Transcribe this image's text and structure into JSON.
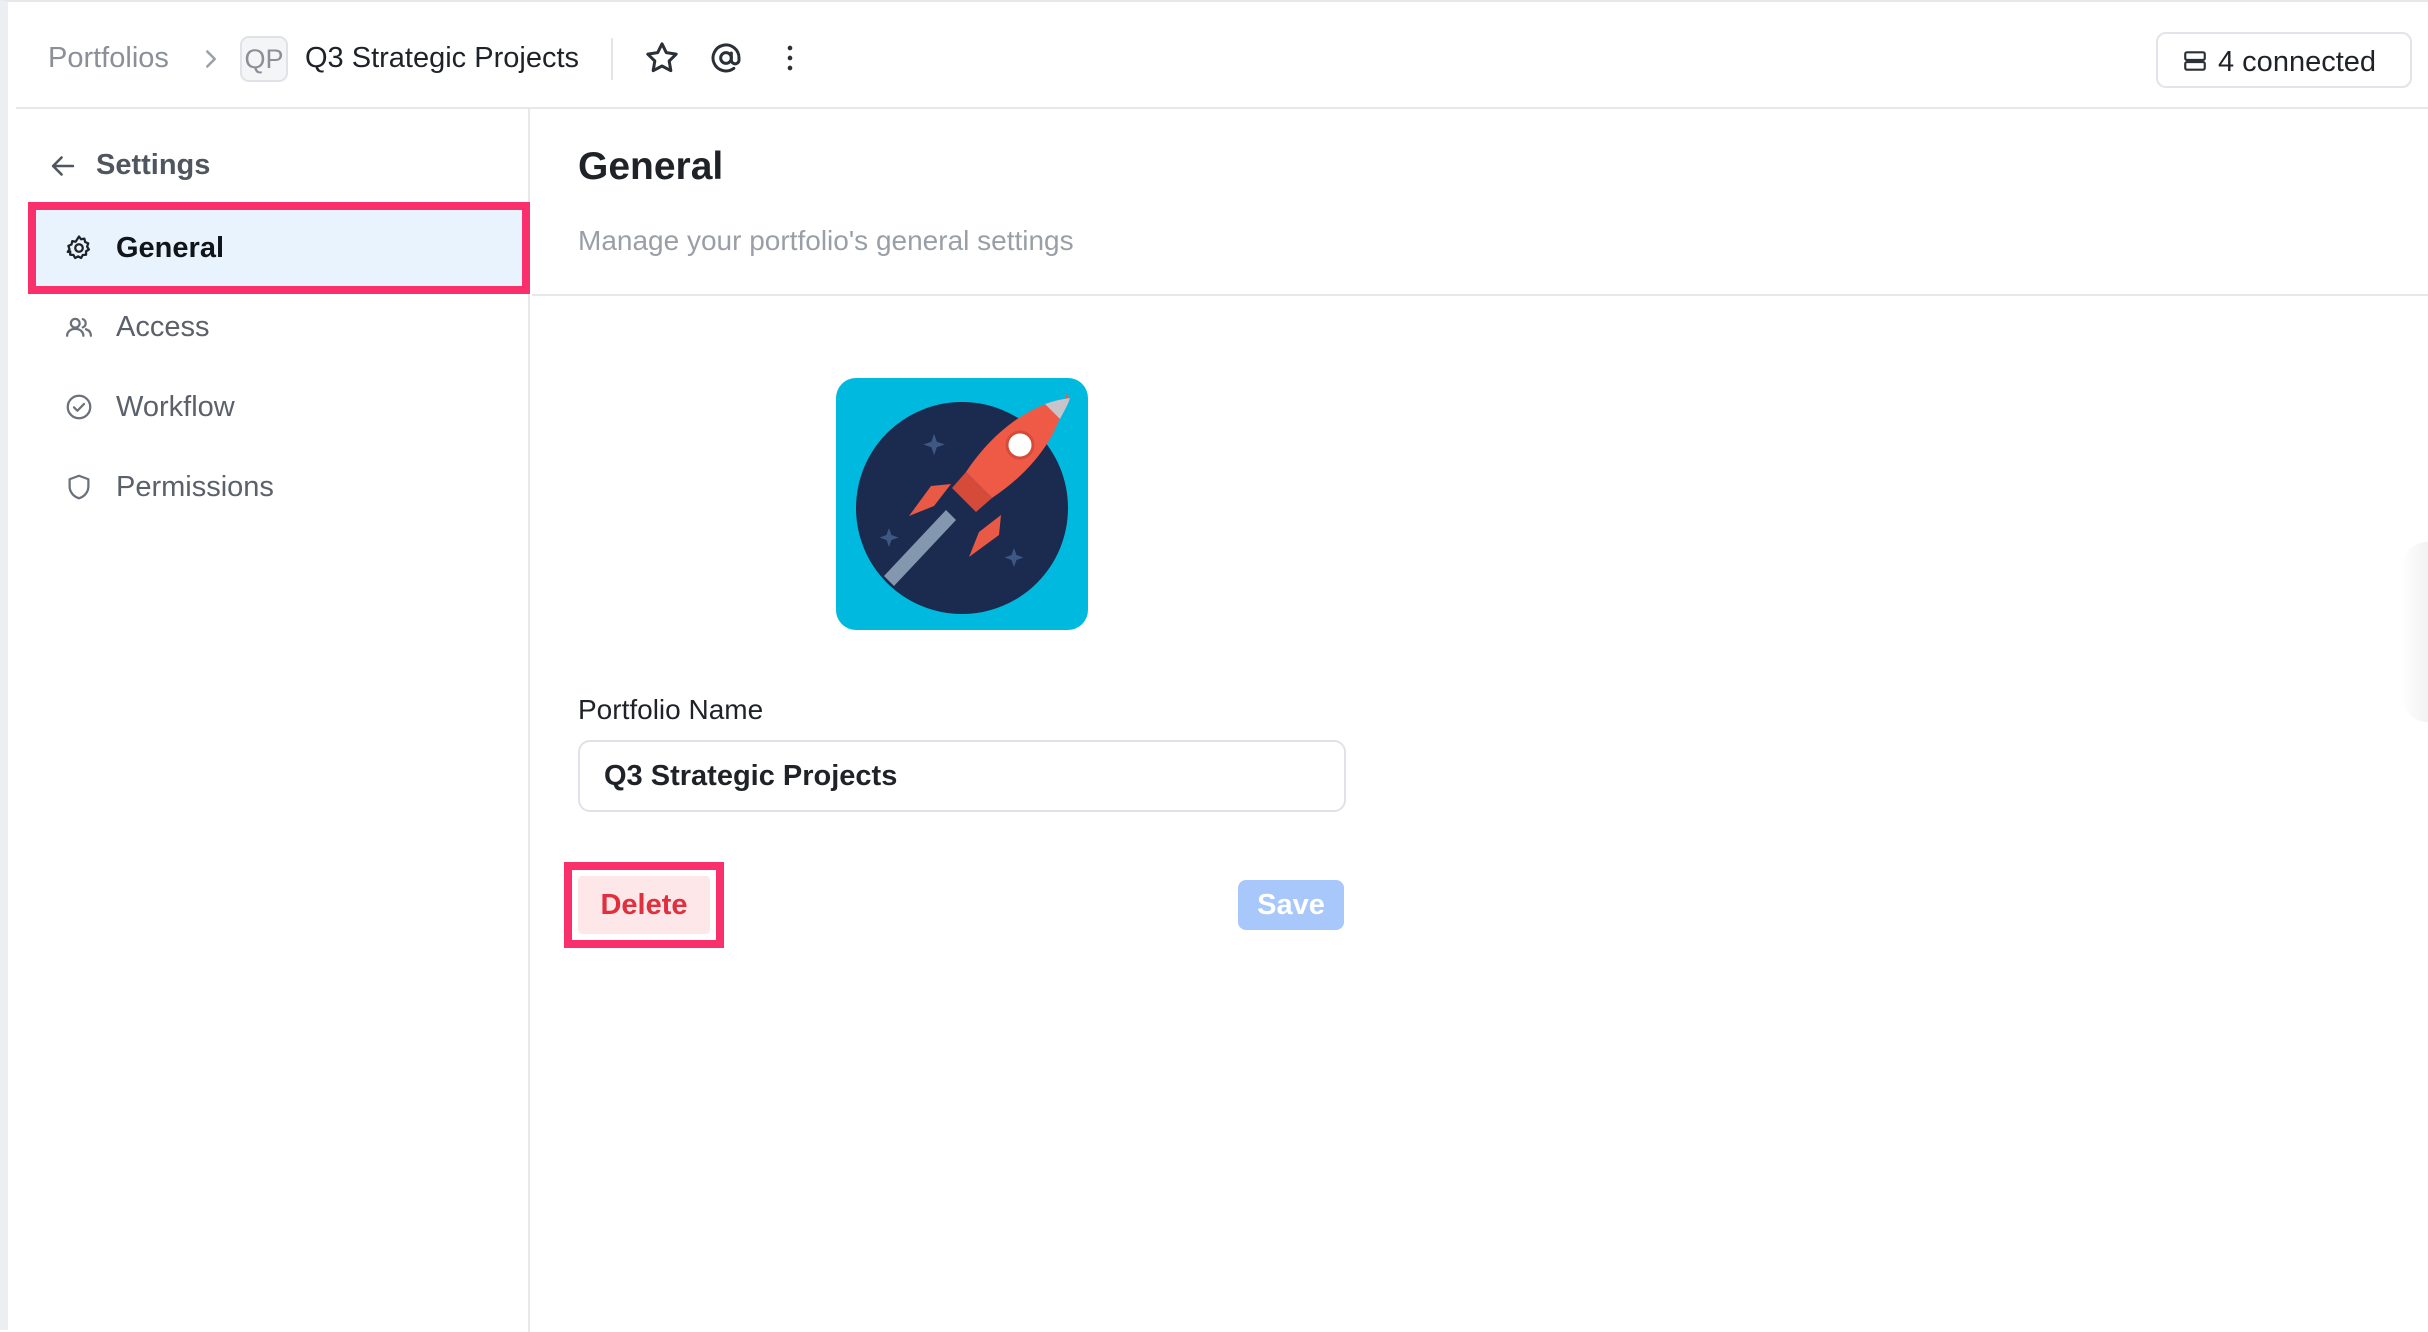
{
  "breadcrumb": {
    "root": "Portfolios",
    "badge": "QP",
    "current": "Q3 Strategic Projects"
  },
  "header_actions": {
    "icons": [
      "star-icon",
      "at-sign-icon",
      "more-vertical-icon"
    ],
    "connected_label": "4 connected"
  },
  "sidebar": {
    "back_label": "Settings",
    "items": [
      {
        "label": "General",
        "icon": "gear-icon",
        "active": true
      },
      {
        "label": "Access",
        "icon": "users-icon",
        "active": false
      },
      {
        "label": "Workflow",
        "icon": "check-circle-icon",
        "active": false
      },
      {
        "label": "Permissions",
        "icon": "shield-icon",
        "active": false
      }
    ]
  },
  "main": {
    "title": "General",
    "subtitle": "Manage your portfolio's general settings",
    "avatar_icon": "rocket-icon",
    "name_label": "Portfolio Name",
    "name_value": "Q3 Strategic Projects",
    "delete_label": "Delete",
    "save_label": "Save"
  },
  "colors": {
    "highlight": "#f9306b",
    "active_bg": "#e8f3fd",
    "avatar_bg": "#00b9de",
    "delete_text": "#e0303e",
    "save_bg": "#a8c8fb"
  }
}
